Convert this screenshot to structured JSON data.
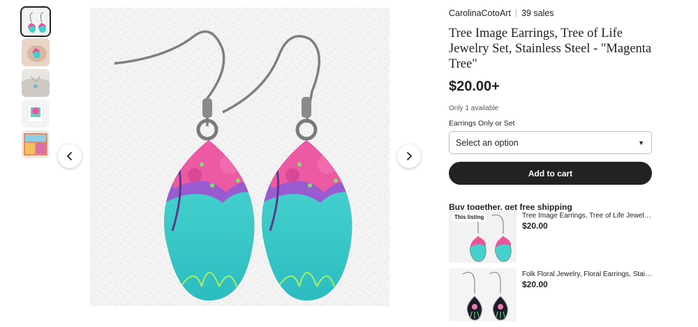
{
  "shop": {
    "name": "CarolinaCotoArt",
    "sales": "39 sales"
  },
  "listing": {
    "title": "Tree Image Earrings, Tree of Life Jewelry Set, Stainless Steel - \"Magenta Tree\"",
    "price": "$20.00+",
    "availability": "Only 1 available",
    "option_label": "Earrings Only or Set",
    "option_selected": "Select an option",
    "add_to_cart": "Add to cart"
  },
  "gallery": {
    "thumbnail_count": 5,
    "active_index": 0,
    "icons": {
      "prev": "chevron-left-icon",
      "next": "chevron-right-icon",
      "dropdown": "caret-down-icon"
    }
  },
  "bundle": {
    "heading": "Buy together, get free shipping",
    "items": [
      {
        "badge": "This listing",
        "name": "Tree Image Earrings, Tree of Life Jewelry S...",
        "price": "$20.00"
      },
      {
        "badge": "",
        "name": "Folk Floral Jewelry, Floral Earrings, Stainles...",
        "price": "$20.00"
      }
    ]
  },
  "colors": {
    "button_dark": "#222222",
    "earring_magenta": "#e8559b",
    "earring_turquoise": "#3fd0c9",
    "earring_purple": "#8a56c8"
  }
}
